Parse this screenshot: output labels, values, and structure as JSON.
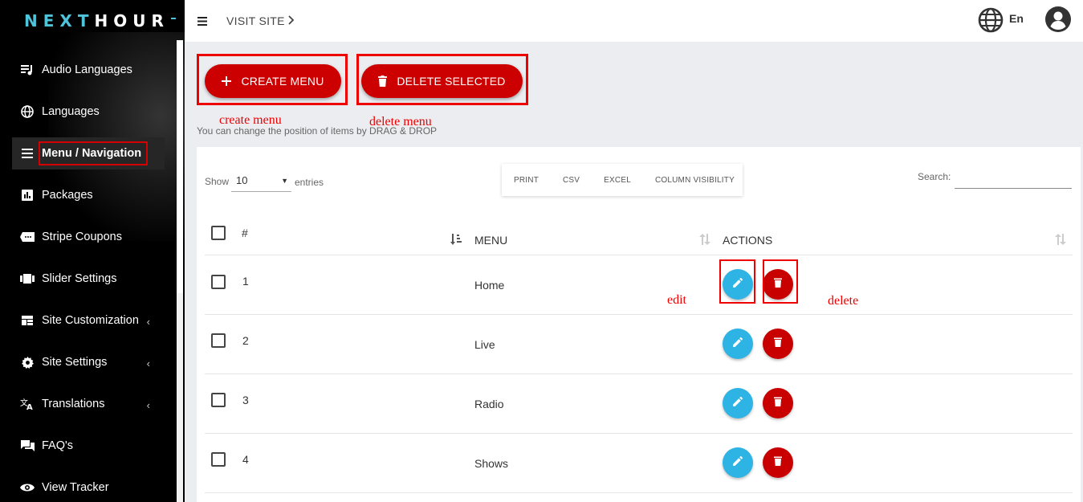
{
  "brand": {
    "logo_prefix": "NEXT",
    "logo_suffix": "HOUR"
  },
  "topbar": {
    "visit_site": "VISIT SITE",
    "language": "En"
  },
  "sidebar": {
    "items": [
      {
        "label": "Audio Languages",
        "icon": "audio-list-icon"
      },
      {
        "label": "Languages",
        "icon": "globe-icon"
      },
      {
        "label": "Menu / Navigation",
        "icon": "menu-icon",
        "active": true
      },
      {
        "label": "Packages",
        "icon": "chart-icon"
      },
      {
        "label": "Stripe Coupons",
        "icon": "coupon-icon"
      },
      {
        "label": "Slider Settings",
        "icon": "slider-icon"
      },
      {
        "label": "Site Customization",
        "icon": "dashboard-icon",
        "expandable": true
      },
      {
        "label": "Site Settings",
        "icon": "gear-icon",
        "expandable": true
      },
      {
        "label": "Translations",
        "icon": "translate-icon",
        "expandable": true
      },
      {
        "label": "FAQ's",
        "icon": "chat-icon"
      },
      {
        "label": "View Tracker",
        "icon": "eye-icon"
      }
    ]
  },
  "actions": {
    "create_label": "CREATE MENU",
    "delete_selected_label": "DELETE SELECTED"
  },
  "annotations": {
    "create": "create menu",
    "delete_menu": "delete menu",
    "edit": "edit",
    "delete": "delete"
  },
  "hint": "You can change the position of items by DRAG & DROP",
  "table_controls": {
    "show_label": "Show",
    "entries_value": "10",
    "entries_label": "entries",
    "buttons": [
      "PRINT",
      "CSV",
      "EXCEL",
      "COLUMN VISIBILITY"
    ],
    "search_label": "Search:"
  },
  "table": {
    "headers": {
      "num": "#",
      "menu": "MENU",
      "actions": "ACTIONS"
    },
    "rows": [
      {
        "num": "1",
        "menu": "Home"
      },
      {
        "num": "2",
        "menu": "Live"
      },
      {
        "num": "3",
        "menu": "Radio"
      },
      {
        "num": "4",
        "menu": "Shows"
      }
    ]
  },
  "colors": {
    "accent_red": "#cc0000",
    "edit_blue": "#2eb3e5",
    "logo_cyan": "#4fc3d9",
    "annotation_red": "#ee0000"
  }
}
